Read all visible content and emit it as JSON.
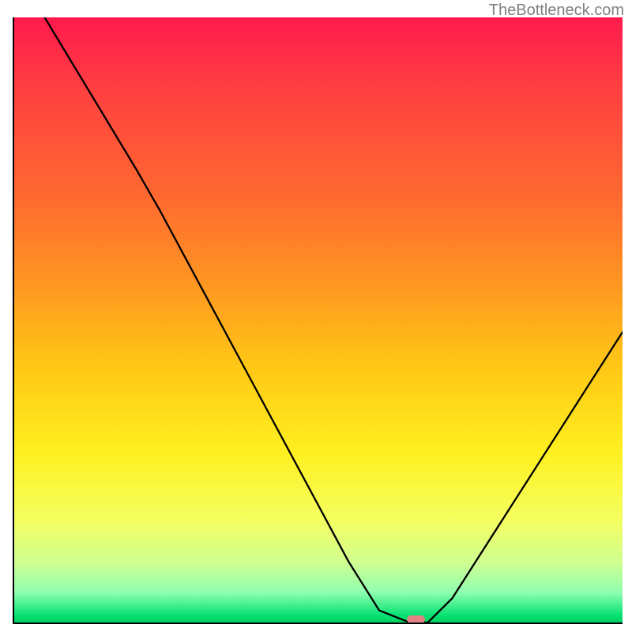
{
  "watermark": "TheBottleneck.com",
  "chart_data": {
    "type": "line",
    "title": "",
    "xlabel": "",
    "ylabel": "",
    "ylim": [
      0,
      100
    ],
    "curve_points": [
      {
        "x": 5,
        "y": 100
      },
      {
        "x": 20,
        "y": 75
      },
      {
        "x": 24,
        "y": 68
      },
      {
        "x": 55,
        "y": 10
      },
      {
        "x": 60,
        "y": 2
      },
      {
        "x": 65,
        "y": 0
      },
      {
        "x": 68,
        "y": 0
      },
      {
        "x": 72,
        "y": 4
      },
      {
        "x": 100,
        "y": 48
      }
    ],
    "marker": {
      "x": 66,
      "y": 0,
      "width_pct": 3
    },
    "background_gradient": {
      "top_color": "#ff1a4d",
      "mid_color": "#ffd020",
      "bottom_color": "#00d060"
    }
  }
}
